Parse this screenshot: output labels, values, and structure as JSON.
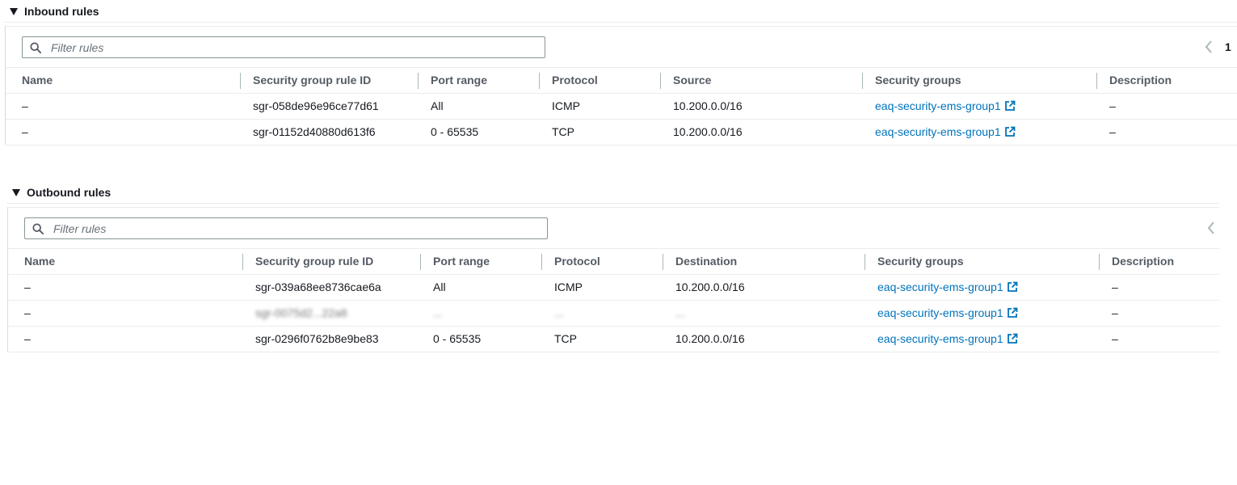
{
  "inbound": {
    "title": "Inbound rules",
    "filter_placeholder": "Filter rules",
    "page_number": "1",
    "columns": [
      "Name",
      "Security group rule ID",
      "Port range",
      "Protocol",
      "Source",
      "Security groups",
      "Description"
    ],
    "rows": [
      {
        "name": "–",
        "rule_id": "sgr-058de96e96ce77d61",
        "port_range": "All",
        "protocol": "ICMP",
        "source": "10.200.0.0/16",
        "security_group": "eaq-security-ems-group1",
        "description": "–"
      },
      {
        "name": "–",
        "rule_id": "sgr-01152d40880d613f6",
        "port_range": "0 - 65535",
        "protocol": "TCP",
        "source": "10.200.0.0/16",
        "security_group": "eaq-security-ems-group1",
        "description": "–"
      }
    ]
  },
  "outbound": {
    "title": "Outbound rules",
    "filter_placeholder": "Filter rules",
    "columns": [
      "Name",
      "Security group rule ID",
      "Port range",
      "Protocol",
      "Destination",
      "Security groups",
      "Description"
    ],
    "rows": [
      {
        "name": "–",
        "rule_id": "sgr-039a68ee8736cae6a",
        "port_range": "All",
        "protocol": "ICMP",
        "destination": "10.200.0.0/16",
        "security_group": "eaq-security-ems-group1",
        "description": "–"
      },
      {
        "name": "–",
        "rule_id": "sgr-0075d2...22a8",
        "port_range": "...",
        "protocol": "...",
        "destination": "...",
        "security_group": "eaq-security-ems-group1",
        "description": "–"
      },
      {
        "name": "–",
        "rule_id": "sgr-0296f0762b8e9be83",
        "port_range": "0 - 65535",
        "protocol": "TCP",
        "destination": "10.200.0.0/16",
        "security_group": "eaq-security-ems-group1",
        "description": "–"
      }
    ]
  },
  "colors": {
    "link": "#0073bb",
    "header_text": "#545b64",
    "border": "#eaeded"
  },
  "icons": {
    "collapse": "caret-down-icon",
    "search": "search-icon",
    "pagination_prev": "chevron-left-icon",
    "external": "external-link-icon"
  }
}
